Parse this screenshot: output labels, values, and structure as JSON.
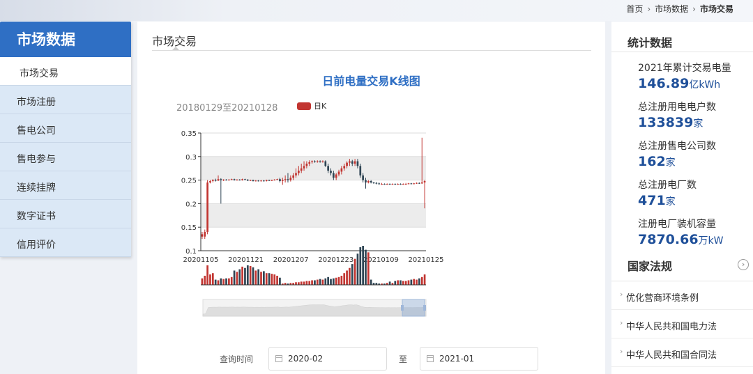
{
  "breadcrumb": [
    "首页",
    "市场数据",
    "市场交易"
  ],
  "sidebar": {
    "title": "市场数据",
    "items": [
      {
        "label": "市场交易",
        "active": true
      },
      {
        "label": "市场注册"
      },
      {
        "label": "售电公司"
      },
      {
        "label": "售电参与"
      },
      {
        "label": "连续挂牌"
      },
      {
        "label": "数字证书"
      },
      {
        "label": "信用评价"
      }
    ]
  },
  "main": {
    "title": "市场交易",
    "chart_title": "日前电量交易K线图",
    "date_range": "20180129至20210128",
    "legend": "日K",
    "query_label": "查询时间",
    "to_label": "至",
    "start_date": "2020-02",
    "end_date": "2021-01"
  },
  "stats": {
    "title": "统计数据",
    "items": [
      {
        "label": "2021年累计交易电量",
        "value": "146.89",
        "unit": "亿kWh"
      },
      {
        "label": "总注册用电电户数",
        "value": "133839",
        "unit": "家"
      },
      {
        "label": "总注册售电公司数",
        "value": "162",
        "unit": "家"
      },
      {
        "label": "总注册电厂数",
        "value": "471",
        "unit": "家"
      },
      {
        "label": "注册电厂装机容量",
        "value": "7870.66",
        "unit": "万kW"
      }
    ]
  },
  "laws": {
    "title": "国家法规",
    "items": [
      {
        "label": "优化营商环境条例"
      },
      {
        "label": "中华人民共和国电力法"
      },
      {
        "label": "中华人民共和国合同法"
      }
    ]
  },
  "colors": {
    "up": "#c23531",
    "down": "#2f4554",
    "accent": "#2f6fc4"
  },
  "chart_data": {
    "type": "candlestick",
    "x_ticks": [
      "20201105",
      "20201121",
      "20201207",
      "20201223",
      "20210109",
      "20210125"
    ],
    "y_ticks": [
      0.1,
      0.15,
      0.2,
      0.25,
      0.3,
      0.35
    ],
    "ylim": [
      0.1,
      0.35
    ],
    "points": [
      {
        "o": 0.13,
        "c": 0.135,
        "l": 0.125,
        "h": 0.14,
        "v": 10
      },
      {
        "o": 0.13,
        "c": 0.14,
        "l": 0.125,
        "h": 0.145,
        "v": 14
      },
      {
        "o": 0.14,
        "c": 0.245,
        "l": 0.135,
        "h": 0.25,
        "v": 30
      },
      {
        "o": 0.245,
        "c": 0.248,
        "l": 0.243,
        "h": 0.25,
        "v": 16
      },
      {
        "o": 0.248,
        "c": 0.25,
        "l": 0.245,
        "h": 0.252,
        "v": 18
      },
      {
        "o": 0.25,
        "c": 0.249,
        "l": 0.247,
        "h": 0.253,
        "v": 8
      },
      {
        "o": 0.249,
        "c": 0.252,
        "l": 0.248,
        "h": 0.26,
        "v": 7
      },
      {
        "o": 0.252,
        "c": 0.25,
        "l": 0.2,
        "h": 0.254,
        "v": 10
      },
      {
        "o": 0.25,
        "c": 0.251,
        "l": 0.248,
        "h": 0.252,
        "v": 9
      },
      {
        "o": 0.251,
        "c": 0.25,
        "l": 0.249,
        "h": 0.252,
        "v": 10
      },
      {
        "o": 0.25,
        "c": 0.251,
        "l": 0.249,
        "h": 0.252,
        "v": 10
      },
      {
        "o": 0.251,
        "c": 0.252,
        "l": 0.25,
        "h": 0.253,
        "v": 12
      },
      {
        "o": 0.252,
        "c": 0.25,
        "l": 0.249,
        "h": 0.253,
        "v": 22
      },
      {
        "o": 0.25,
        "c": 0.251,
        "l": 0.249,
        "h": 0.252,
        "v": 20
      },
      {
        "o": 0.251,
        "c": 0.25,
        "l": 0.249,
        "h": 0.252,
        "v": 24
      },
      {
        "o": 0.25,
        "c": 0.252,
        "l": 0.249,
        "h": 0.253,
        "v": 28
      },
      {
        "o": 0.252,
        "c": 0.251,
        "l": 0.25,
        "h": 0.253,
        "v": 26
      },
      {
        "o": 0.251,
        "c": 0.249,
        "l": 0.248,
        "h": 0.252,
        "v": 30
      },
      {
        "o": 0.249,
        "c": 0.25,
        "l": 0.248,
        "h": 0.251,
        "v": 29
      },
      {
        "o": 0.25,
        "c": 0.248,
        "l": 0.247,
        "h": 0.251,
        "v": 27
      },
      {
        "o": 0.248,
        "c": 0.249,
        "l": 0.247,
        "h": 0.25,
        "v": 22
      },
      {
        "o": 0.249,
        "c": 0.248,
        "l": 0.247,
        "h": 0.25,
        "v": 24
      },
      {
        "o": 0.248,
        "c": 0.249,
        "l": 0.247,
        "h": 0.25,
        "v": 20
      },
      {
        "o": 0.249,
        "c": 0.248,
        "l": 0.247,
        "h": 0.25,
        "v": 21
      },
      {
        "o": 0.248,
        "c": 0.25,
        "l": 0.247,
        "h": 0.251,
        "v": 18
      },
      {
        "o": 0.25,
        "c": 0.249,
        "l": 0.248,
        "h": 0.251,
        "v": 18
      },
      {
        "o": 0.249,
        "c": 0.25,
        "l": 0.248,
        "h": 0.251,
        "v": 17
      },
      {
        "o": 0.25,
        "c": 0.251,
        "l": 0.249,
        "h": 0.252,
        "v": 16
      },
      {
        "o": 0.251,
        "c": 0.252,
        "l": 0.25,
        "h": 0.253,
        "v": 14
      },
      {
        "o": 0.252,
        "c": 0.248,
        "l": 0.245,
        "h": 0.255,
        "v": 11
      },
      {
        "o": 0.248,
        "c": 0.25,
        "l": 0.24,
        "h": 0.255,
        "v": 2
      },
      {
        "o": 0.25,
        "c": 0.252,
        "l": 0.245,
        "h": 0.26,
        "v": 3
      },
      {
        "o": 0.252,
        "c": 0.25,
        "l": 0.245,
        "h": 0.265,
        "v": 2
      },
      {
        "o": 0.25,
        "c": 0.255,
        "l": 0.247,
        "h": 0.26,
        "v": 3
      },
      {
        "o": 0.255,
        "c": 0.26,
        "l": 0.25,
        "h": 0.265,
        "v": 3
      },
      {
        "o": 0.26,
        "c": 0.265,
        "l": 0.255,
        "h": 0.275,
        "v": 4
      },
      {
        "o": 0.265,
        "c": 0.27,
        "l": 0.26,
        "h": 0.28,
        "v": 4
      },
      {
        "o": 0.27,
        "c": 0.275,
        "l": 0.265,
        "h": 0.285,
        "v": 5
      },
      {
        "o": 0.275,
        "c": 0.28,
        "l": 0.27,
        "h": 0.29,
        "v": 5
      },
      {
        "o": 0.28,
        "c": 0.285,
        "l": 0.275,
        "h": 0.29,
        "v": 6
      },
      {
        "o": 0.285,
        "c": 0.288,
        "l": 0.28,
        "h": 0.292,
        "v": 6
      },
      {
        "o": 0.288,
        "c": 0.29,
        "l": 0.285,
        "h": 0.292,
        "v": 7
      },
      {
        "o": 0.29,
        "c": 0.289,
        "l": 0.287,
        "h": 0.292,
        "v": 7
      },
      {
        "o": 0.289,
        "c": 0.29,
        "l": 0.287,
        "h": 0.292,
        "v": 8
      },
      {
        "o": 0.29,
        "c": 0.289,
        "l": 0.287,
        "h": 0.292,
        "v": 9
      },
      {
        "o": 0.289,
        "c": 0.29,
        "l": 0.287,
        "h": 0.292,
        "v": 8
      },
      {
        "o": 0.29,
        "c": 0.28,
        "l": 0.278,
        "h": 0.292,
        "v": 10
      },
      {
        "o": 0.28,
        "c": 0.27,
        "l": 0.265,
        "h": 0.285,
        "v": 12
      },
      {
        "o": 0.27,
        "c": 0.265,
        "l": 0.26,
        "h": 0.275,
        "v": 9
      },
      {
        "o": 0.265,
        "c": 0.255,
        "l": 0.25,
        "h": 0.27,
        "v": 10
      },
      {
        "o": 0.255,
        "c": 0.262,
        "l": 0.25,
        "h": 0.265,
        "v": 11
      },
      {
        "o": 0.262,
        "c": 0.268,
        "l": 0.258,
        "h": 0.272,
        "v": 12
      },
      {
        "o": 0.268,
        "c": 0.275,
        "l": 0.262,
        "h": 0.28,
        "v": 14
      },
      {
        "o": 0.275,
        "c": 0.28,
        "l": 0.27,
        "h": 0.285,
        "v": 18
      },
      {
        "o": 0.28,
        "c": 0.287,
        "l": 0.275,
        "h": 0.29,
        "v": 22
      },
      {
        "o": 0.287,
        "c": 0.29,
        "l": 0.28,
        "h": 0.295,
        "v": 26
      },
      {
        "o": 0.29,
        "c": 0.285,
        "l": 0.28,
        "h": 0.293,
        "v": 32
      },
      {
        "o": 0.285,
        "c": 0.29,
        "l": 0.28,
        "h": 0.295,
        "v": 40
      },
      {
        "o": 0.29,
        "c": 0.28,
        "l": 0.275,
        "h": 0.295,
        "v": 48
      },
      {
        "o": 0.28,
        "c": 0.26,
        "l": 0.255,
        "h": 0.285,
        "v": 58
      },
      {
        "o": 0.26,
        "c": 0.25,
        "l": 0.245,
        "h": 0.265,
        "v": 60
      },
      {
        "o": 0.25,
        "c": 0.245,
        "l": 0.232,
        "h": 0.255,
        "v": 54
      },
      {
        "o": 0.245,
        "c": 0.248,
        "l": 0.243,
        "h": 0.25,
        "v": 50
      },
      {
        "o": 0.248,
        "c": 0.245,
        "l": 0.243,
        "h": 0.25,
        "v": 8
      },
      {
        "o": 0.245,
        "c": 0.244,
        "l": 0.242,
        "h": 0.246,
        "v": 3
      },
      {
        "o": 0.244,
        "c": 0.243,
        "l": 0.241,
        "h": 0.246,
        "v": 3
      },
      {
        "o": 0.243,
        "c": 0.242,
        "l": 0.24,
        "h": 0.245,
        "v": 2
      },
      {
        "o": 0.242,
        "c": 0.242,
        "l": 0.24,
        "h": 0.244,
        "v": 2
      },
      {
        "o": 0.242,
        "c": 0.241,
        "l": 0.24,
        "h": 0.243,
        "v": 2
      },
      {
        "o": 0.241,
        "c": 0.242,
        "l": 0.24,
        "h": 0.243,
        "v": 3
      },
      {
        "o": 0.242,
        "c": 0.241,
        "l": 0.24,
        "h": 0.243,
        "v": 5
      },
      {
        "o": 0.241,
        "c": 0.242,
        "l": 0.24,
        "h": 0.243,
        "v": 3
      },
      {
        "o": 0.242,
        "c": 0.241,
        "l": 0.24,
        "h": 0.243,
        "v": 6
      },
      {
        "o": 0.241,
        "c": 0.242,
        "l": 0.24,
        "h": 0.243,
        "v": 7
      },
      {
        "o": 0.242,
        "c": 0.241,
        "l": 0.24,
        "h": 0.243,
        "v": 7
      },
      {
        "o": 0.241,
        "c": 0.242,
        "l": 0.24,
        "h": 0.243,
        "v": 6
      },
      {
        "o": 0.242,
        "c": 0.242,
        "l": 0.24,
        "h": 0.244,
        "v": 6
      },
      {
        "o": 0.242,
        "c": 0.243,
        "l": 0.241,
        "h": 0.244,
        "v": 7
      },
      {
        "o": 0.243,
        "c": 0.242,
        "l": 0.241,
        "h": 0.244,
        "v": 8
      },
      {
        "o": 0.242,
        "c": 0.243,
        "l": 0.241,
        "h": 0.244,
        "v": 9
      },
      {
        "o": 0.243,
        "c": 0.244,
        "l": 0.242,
        "h": 0.245,
        "v": 8
      },
      {
        "o": 0.244,
        "c": 0.243,
        "l": 0.242,
        "h": 0.245,
        "v": 10
      },
      {
        "o": 0.243,
        "c": 0.245,
        "l": 0.242,
        "h": 0.34,
        "v": 12
      },
      {
        "o": 0.245,
        "c": 0.248,
        "l": 0.19,
        "h": 0.25,
        "v": 16
      }
    ]
  }
}
